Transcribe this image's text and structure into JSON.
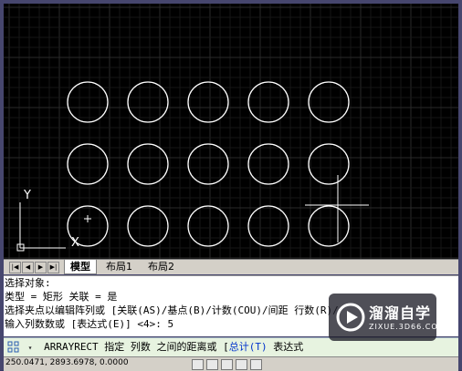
{
  "colors": {
    "accent": "#2f7bd6",
    "canvas_bg": "#000000",
    "input_bar_bg": "#e7f3e0"
  },
  "viewport": {
    "ucs_y_label": "Y",
    "ucs_x_label": "X",
    "array": {
      "rows": 3,
      "columns": 5
    }
  },
  "layout_tabs": {
    "nav_buttons": [
      "|◀",
      "◀",
      "▶",
      "▶|"
    ],
    "tabs": [
      {
        "label": "模型",
        "active": true
      },
      {
        "label": "布局1",
        "active": false
      },
      {
        "label": "布局2",
        "active": false
      }
    ]
  },
  "command_history": [
    "选择对象:",
    "类型 = 矩形  关联 = 是",
    "选择夹点以编辑阵列或 [关联(AS)/基点(B)/计数(COU)/间距 行数(R)/",
    "输入列数数或 [表达式(E)] <4>: 5"
  ],
  "command_input": {
    "icon": "command-grid-icon",
    "text_parts": [
      {
        "text": "ARRAYRECT 指定 列数 之间的距离或 [",
        "color": "#000000"
      },
      {
        "text": "总计(T)",
        "color": "#0033cc"
      },
      {
        "text": " 表达式",
        "color": "#000000"
      }
    ]
  },
  "status_bar": {
    "coords": "250.0471, 2893.6978, 0.0000"
  },
  "watermark": {
    "brand": "溜溜自学",
    "url": "ZIXUE.3D66.COM"
  }
}
